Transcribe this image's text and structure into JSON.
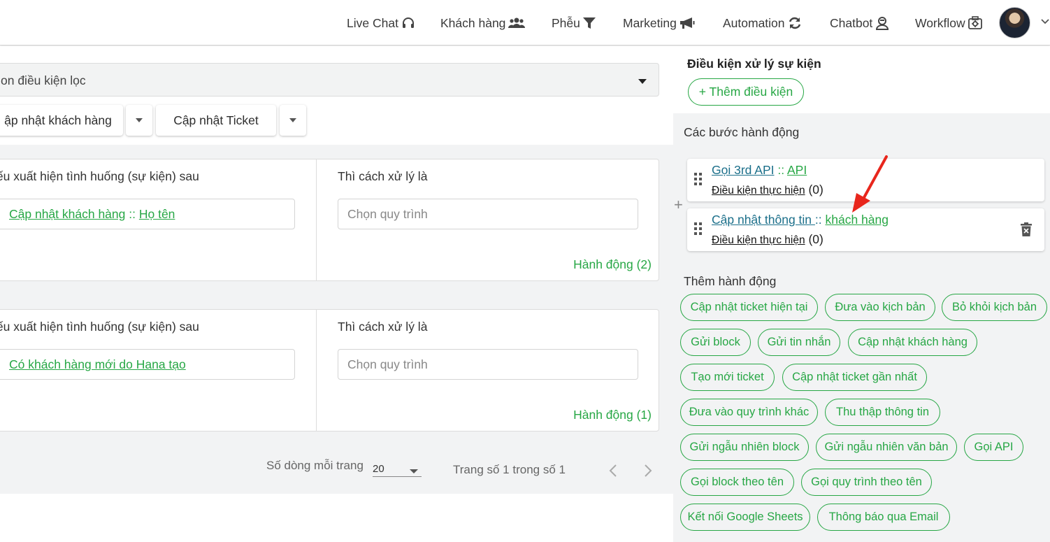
{
  "nav": {
    "items": [
      {
        "label": "Live Chat",
        "icon": "headset-icon"
      },
      {
        "label": "Khách hàng",
        "icon": "users-icon"
      },
      {
        "label": "Phễu",
        "icon": "funnel-icon"
      },
      {
        "label": "Marketing",
        "icon": "megaphone-icon"
      },
      {
        "label": "Automation",
        "icon": "sync-icon"
      },
      {
        "label": "Chatbot",
        "icon": "bot-icon"
      },
      {
        "label": "Workflow",
        "icon": "workflow-icon"
      }
    ]
  },
  "left": {
    "filter_placeholder": "on điều kiện lọc",
    "buttons": {
      "update_customer": "ập nhật khách hàng",
      "update_ticket": "Cập nhật Ticket"
    },
    "rules": [
      {
        "when_label": "lếu xuất hiện tình huống (sự kiện) sau",
        "then_label": "Thì cách xử lý là",
        "event_main": "Cập nhật khách hàng",
        "event_sep": " :: ",
        "event_sub": "Họ tên",
        "flow_placeholder": "Chọn quy trình",
        "actions": "Hành động (2)"
      },
      {
        "when_label": "lếu xuất hiện tình huống (sự kiện) sau",
        "then_label": "Thì cách xử lý là",
        "event_main": "Có khách hàng mới do Hana tạo",
        "flow_placeholder": "Chọn quy trình",
        "actions": "Hành động (1)"
      }
    ],
    "pagination": {
      "rows_label": "Số dòng mỗi trang",
      "rows_value": "20",
      "page_text": "Trang số 1 trong số 1"
    }
  },
  "right": {
    "conditions_title": "Điều kiện xử lý sự kiện",
    "add_condition": "+ Thêm điều kiện",
    "steps_title": "Các bước hành động",
    "steps": [
      {
        "main": "Gọi 3rd API",
        "sep": " :: ",
        "sub": "API",
        "cond_label": "Điều kiện thực hiện",
        "cond_count": " (0)"
      },
      {
        "main": "Cập nhật thông tin ",
        "sep": ":: ",
        "sub": "khách hàng",
        "cond_label": "Điều kiện thực hiện",
        "cond_count": " (0)"
      }
    ],
    "add_actions_title": "Thêm hành động",
    "chips": [
      "Cập nhật ticket hiện tại",
      "Đưa vào kịch bản",
      "Bỏ khỏi kịch bản",
      "Gửi block",
      "Gửi tin nhắn",
      "Cập nhật khách hàng",
      "Tạo mới ticket",
      "Cập nhật ticket gần nhất",
      "Đưa vào quy trình khác",
      "Thu thập thông tin",
      "Gửi ngẫu nhiên block",
      "Gửi ngẫu nhiên văn bản",
      "Gọi API",
      "Gọi block theo tên",
      "Gọi quy trình theo tên",
      "Kết nối Google Sheets",
      "Thông báo qua Email"
    ]
  },
  "colors": {
    "accent_green": "#27a745",
    "link_blue": "#1b6f8a",
    "annotation_red": "#e8261c"
  }
}
